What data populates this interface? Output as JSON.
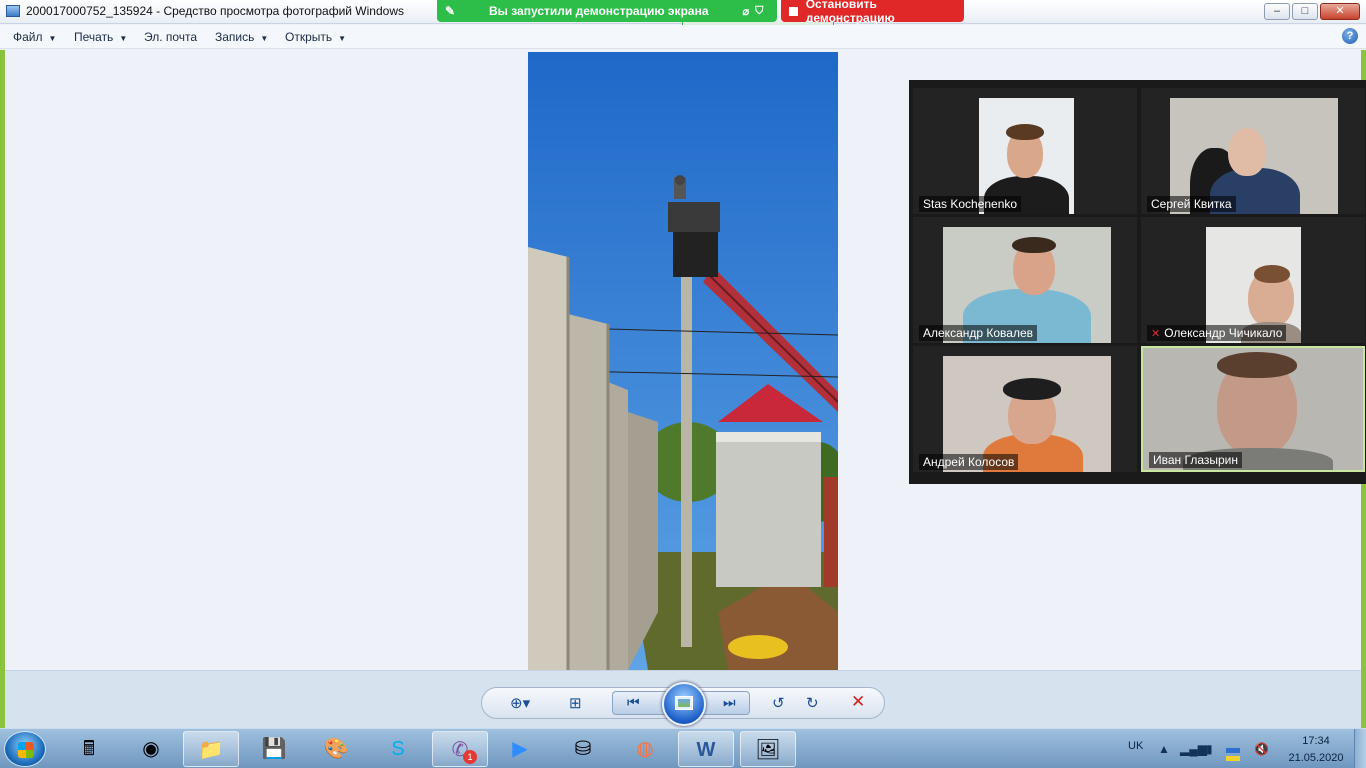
{
  "window": {
    "title": "200017000752_135924 - Средство просмотра фотографий Windows",
    "minimize": "–",
    "maximize": "□",
    "close": "✕"
  },
  "share": {
    "banner": "Вы запустили демонстрацию экрана",
    "stop_label": "Остановить демонстрацию"
  },
  "menu": {
    "file": "Файл",
    "print": "Печать",
    "email": "Эл. почта",
    "burn": "Запись",
    "open": "Открыть",
    "help": "?"
  },
  "participants": [
    {
      "name": "Stas Kochenenko",
      "muted": false
    },
    {
      "name": "Сергей Квитка",
      "muted": false
    },
    {
      "name": "Александр Ковалев",
      "muted": false
    },
    {
      "name": "Олександр Чичикало",
      "muted": true
    },
    {
      "name": "Андрей Колосов",
      "muted": false
    },
    {
      "name": "Иван Глазырин",
      "muted": false,
      "active": true
    }
  ],
  "viewer_controls": {
    "zoom_icon": "zoom-icon",
    "fit_icon": "fit-to-window-icon",
    "prev_icon": "previous-icon",
    "slideshow_icon": "slideshow-icon",
    "next_icon": "next-icon",
    "rotate_left_icon": "rotate-counterclockwise-icon",
    "rotate_right_icon": "rotate-clockwise-icon",
    "delete_icon": "delete-icon"
  },
  "taskbar": {
    "apps": [
      "calculator",
      "chrome",
      "explorer",
      "save-app",
      "paint",
      "skype",
      "viber",
      "zoom",
      "network-tool",
      "firefox",
      "word",
      "photo-viewer"
    ],
    "viber_badge": "1",
    "lang": "UK",
    "time": "17:34",
    "date": "21.05.2020"
  },
  "colors": {
    "share_green": "#2dbe4a",
    "stop_red": "#e02828",
    "active_border": "#c8e6a0"
  }
}
